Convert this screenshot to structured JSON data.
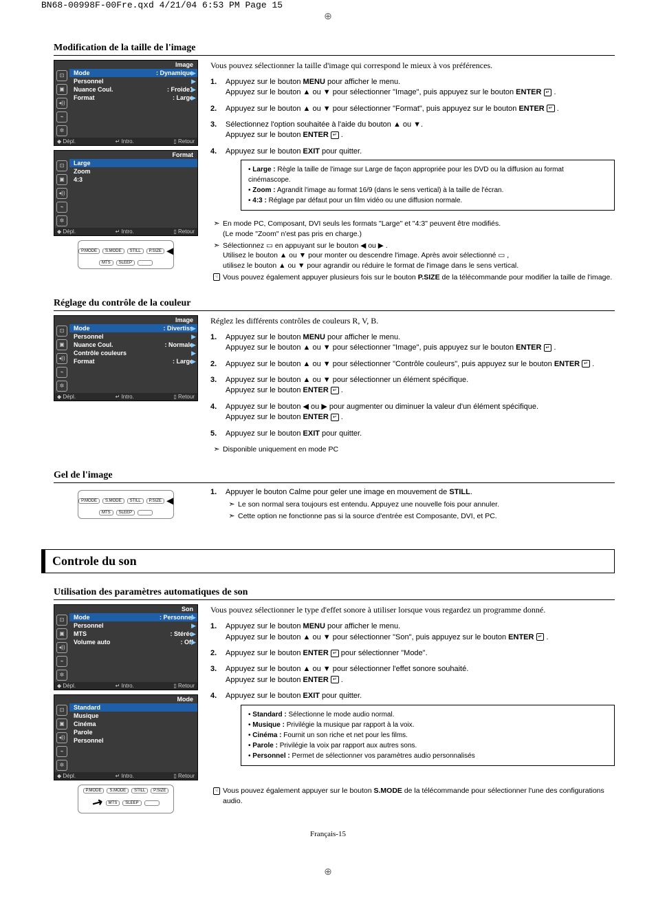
{
  "header_line": "BN68-00998F-00Fre.qxd  4/21/04  6:53 PM  Page 15",
  "page_number": "Français-15",
  "sections": {
    "imgsize": {
      "title": "Modification de la taille de l'image",
      "osd1_title": "Image",
      "osd1": {
        "mode_label": "Mode",
        "mode_val": ": Dynamique",
        "personnel": "Personnel",
        "nuance_label": "Nuance Coul.",
        "nuance_val": ": Froide1",
        "format_label": "Format",
        "format_val": ": Large"
      },
      "osd2_title": "Format",
      "osd2": {
        "large": "Large",
        "zoom": "Zoom",
        "fourthree": "4:3"
      },
      "footer": {
        "depl": "Dépl.",
        "intro": "Intro.",
        "retour": "Retour"
      },
      "intro_text": "Vous pouvez sélectionner la taille d'image qui correspond le mieux à vos préférences.",
      "steps": {
        "s1a": "Appuyez sur le bouton ",
        "s1_menu": "MENU",
        "s1b": " pour afficher le menu.",
        "s1c": "Appuyez sur le bouton ▲ ou ▼ pour sélectionner \"Image\", puis appuyez sur le bouton ",
        "s1_enter": "ENTER",
        "s2": "Appuyez sur le bouton ▲ ou ▼ pour sélectionner \"Format\", puis appuyez sur le bouton ",
        "s3a": "Sélectionnez l'option souhaitée à l'aide du bouton ▲ ou ▼.",
        "s3b": "Appuyez sur le bouton ",
        "s4": "Appuyez sur le bouton ",
        "s4_exit": "EXIT",
        "s4b": " pour quitter."
      },
      "defs": {
        "large_l": "Large :",
        "large_t": " Règle la taille de l'image sur Large de façon appropriée pour les DVD ou la diffusion au format cinémascope.",
        "zoom_l": "Zoom :",
        "zoom_t": " Agrandit l'image au format 16/9 (dans le sens vertical) à la taille de l'écran.",
        "ft_l": "4:3 :",
        "ft_t": " Réglage par défaut pour un film vidéo ou une diffusion normale."
      },
      "notes": {
        "n1a": "En mode PC, Composant, DVI seuls les formats \"Large\" et \"4:3\" peuvent être modifiés.",
        "n1b": "(Le mode \"Zoom\" n'est pas pris en charge.)",
        "n2a": "Sélectionnez ▭ en appuyant sur le bouton ◀ ou ▶ .",
        "n2b": "Utilisez le bouton ▲ ou ▼ pour monter ou descendre l'image. Après avoir sélectionné ▭ ,",
        "n2c": "utilisez le bouton ▲ ou ▼ pour agrandir ou réduire le format de l'image dans le sens vertical.",
        "n3a": "Vous pouvez également appuyer plusieurs fois sur le bouton ",
        "n3_psize": "P.SIZE",
        "n3b": " de la télécommande pour modifier la taille de l'image."
      }
    },
    "colorctrl": {
      "title": "Réglage du contrôle de la couleur",
      "osd_title": "Image",
      "osd": {
        "mode_label": "Mode",
        "mode_val": ": Divertiss",
        "personnel": "Personnel",
        "nuance_label": "Nuance Coul.",
        "nuance_val": ": Normale",
        "cc": "Contrôle couleurs",
        "format_label": "Format",
        "format_val": ": Large"
      },
      "intro": "Réglez les différents contrôles de couleurs R, V, B.",
      "steps": {
        "s1a": "Appuyez sur le bouton ",
        "s1_menu": "MENU",
        "s1b": " pour afficher le menu.",
        "s1c": "Appuyez sur le bouton ▲ ou ▼ pour sélectionner \"Image\", puis appuyez sur le bouton ",
        "s2": "Appuyez sur le bouton ▲ ou ▼ pour sélectionner \"Contrôle couleurs\", puis appuyez sur le bouton ",
        "s3a": "Appuyez sur le bouton ▲ ou ▼ pour sélectionner un élément spécifique.",
        "s3b": "Appuyez sur le bouton ",
        "s4a": "Appuyez sur le bouton ◀ ou ▶ pour augmenter ou diminuer la valeur d'un élément spécifique.",
        "s4b": "Appuyez sur le bouton ",
        "s5": "Appuyez sur le bouton ",
        "s5_exit": "EXIT",
        "s5b": " pour quitter.",
        "note": "Disponible uniquement en mode PC"
      }
    },
    "gel": {
      "title": "Gel de l'image",
      "s1a": "Appuyer le bouton Calme pour geler une image en mouvement de ",
      "s1_still": "STILL",
      "n1": "Le son normal sera toujours est entendu. Appuyez une nouvelle fois pour annuler.",
      "n2": "Cette option ne fonctionne pas si la source d'entrée est Composante, DVI, et PC."
    },
    "sound_header": "Controle du son",
    "autosound": {
      "title": "Utilisation des paramètres automatiques de son",
      "osd1_title": "Son",
      "osd1": {
        "mode_label": "Mode",
        "mode_val": ": Personnel",
        "personnel": "Personnel",
        "mts_label": "MTS",
        "mts_val": ": Stéréo",
        "vol_label": "Volume auto",
        "vol_val": ": Off"
      },
      "osd2_title": "Mode",
      "osd2": {
        "standard": "Standard",
        "musique": "Musique",
        "cinema": "Cinéma",
        "parole": "Parole",
        "personnel": "Personnel"
      },
      "intro": "Vous pouvez sélectionner le type d'effet sonore à utiliser lorsque vous regardez un programme donné.",
      "steps": {
        "s1a": "Appuyez sur le bouton ",
        "s1_menu": "MENU",
        "s1b": " pour afficher le menu.",
        "s1c": "Appuyez sur le bouton ▲ ou ▼ pour sélectionner \"Son\", puis appuyez sur le bouton ",
        "s2": "Appuyez sur le bouton ",
        "s2b": " pour sélectionner \"Mode\".",
        "s3a": "Appuyez sur le bouton ▲ ou ▼ pour sélectionner l'effet sonore souhaité.",
        "s3b": "Appuyez sur le bouton ",
        "s4": "Appuyez sur le bouton ",
        "s4_exit": "EXIT",
        "s4b": " pour quitter."
      },
      "defs": {
        "standard_l": "Standard :",
        "standard_t": " Sélectionne le mode audio normal.",
        "musique_l": "Musique :",
        "musique_t": " Privilégie la musique par rapport à la voix.",
        "cinema_l": "Cinéma :",
        "cinema_t": " Fournit un son riche et net pour les films.",
        "parole_l": "Parole :",
        "parole_t": " Privilégie la voix par rapport aux autres sons.",
        "personnel_l": "Personnel :",
        "personnel_t": " Permet de sélectionner vos paramètres audio personnalisés"
      },
      "footnote_a": "Vous pouvez également appuyer sur le bouton ",
      "footnote_smode": "S.MODE",
      "footnote_b": " de la télécommande pour sélectionner l'une des configurations audio."
    }
  },
  "remote": {
    "pmode": "P.MODE",
    "smode": "S.MODE",
    "still": "STILL",
    "psize": "P.SIZE",
    "mts": "MTS",
    "sleep": "SLEEP"
  },
  "enter_label": "↵",
  "dot": ".",
  "period": " ."
}
